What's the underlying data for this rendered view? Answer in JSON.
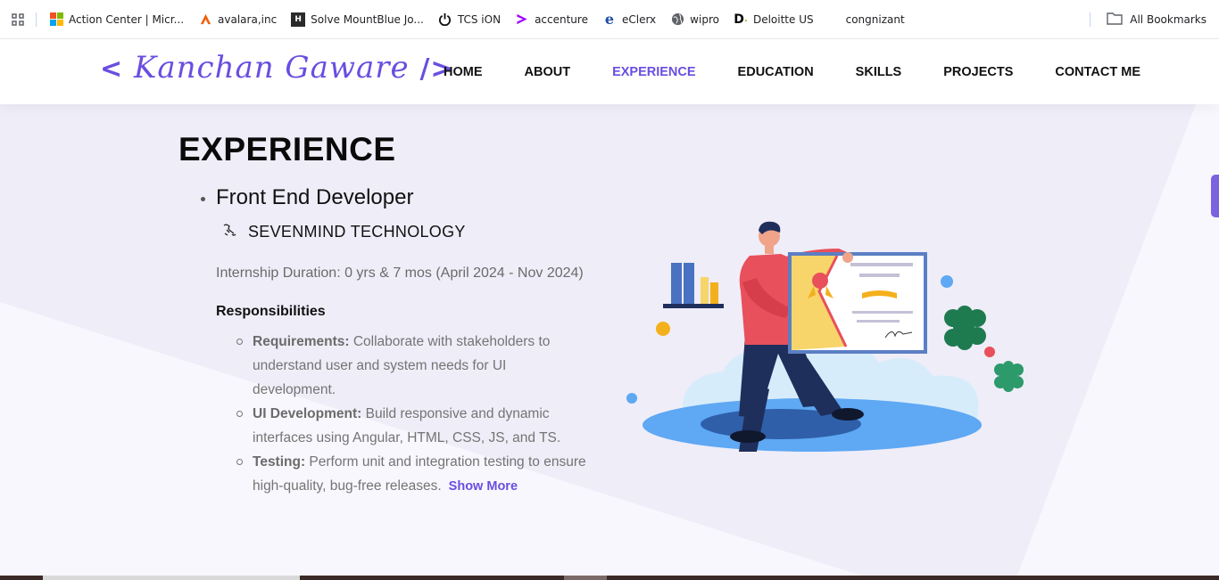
{
  "bookmarks": [
    {
      "label": "Action Center | Micr...",
      "icon": "microsoft-icon"
    },
    {
      "label": "avalara,inc",
      "icon": "avalara-icon"
    },
    {
      "label": "Solve MountBlue Jo...",
      "icon": "hackerearth-icon"
    },
    {
      "label": "TCS iON",
      "icon": "power-icon"
    },
    {
      "label": "accenture",
      "icon": "accenture-icon"
    },
    {
      "label": "eClerx",
      "icon": "eclerx-icon"
    },
    {
      "label": "wipro",
      "icon": "globe-icon"
    },
    {
      "label": "Deloitte US",
      "icon": "deloitte-icon"
    },
    {
      "label": "congnizant",
      "icon": ""
    }
  ],
  "all_bookmarks_label": "All Bookmarks",
  "logo": {
    "open": "<",
    "name": "Kanchan Gaware",
    "close": "/>"
  },
  "nav": {
    "items": [
      "HOME",
      "ABOUT",
      "EXPERIENCE",
      "EDUCATION",
      "SKILLS",
      "PROJECTS",
      "CONTACT ME"
    ],
    "active": "EXPERIENCE"
  },
  "section_title": "EXPERIENCE",
  "experience": {
    "role": "Front End Developer",
    "company": "SEVENMIND TECHNOLOGY",
    "duration": "Internship Duration: 0 yrs & 7 mos (April 2024 - Nov 2024)",
    "responsibilities_title": "Responsibilities",
    "responsibilities": [
      {
        "label": "Requirements:",
        "text": " Collaborate with stakeholders to understand user and system needs for UI development."
      },
      {
        "label": "UI Development:",
        "text": " Build responsive and dynamic interfaces using Angular, HTML, CSS, JS, and TS."
      },
      {
        "label": "Testing:",
        "text": " Perform unit and integration testing to ensure high-quality, bug-free releases."
      }
    ],
    "show_more": "Show More"
  },
  "colors": {
    "accent": "#6a4ee0",
    "background": "#f8f7fd",
    "illustration_red": "#e8505b",
    "illustration_blue": "#4a90e2"
  }
}
